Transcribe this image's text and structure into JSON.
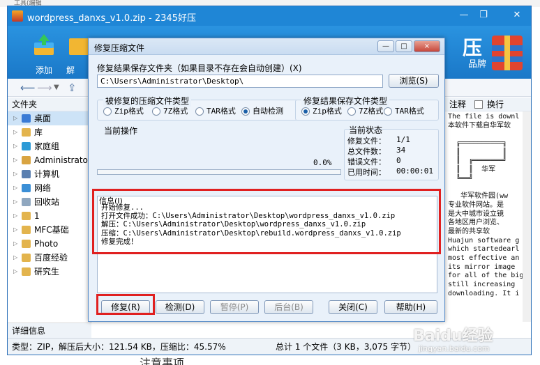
{
  "background": {
    "top_text": "工具(编辑",
    "bottom_text": "注意事项"
  },
  "app": {
    "title": "wordpress_danxs_v1.0.zip - 2345好压",
    "toolbar": {
      "add_label": "添加",
      "extract_label": "解"
    },
    "brand": "压",
    "brand_sub": "品牌"
  },
  "left_panel": {
    "header": "文件夹",
    "items": [
      {
        "label": "桌面",
        "selected": true,
        "icon_color": "#3a7bd5"
      },
      {
        "label": "库",
        "icon_color": "#e3b44d"
      },
      {
        "label": "家庭组",
        "icon_color": "#2c9ad6"
      },
      {
        "label": "Administrator",
        "icon_color": "#d9a441"
      },
      {
        "label": "计算机",
        "icon_color": "#5a7fb0"
      },
      {
        "label": "网络",
        "icon_color": "#3b8fd6"
      },
      {
        "label": "回收站",
        "icon_color": "#8fa7bf"
      },
      {
        "label": "1",
        "icon_color": "#e3b44d"
      },
      {
        "label": "MFC基础",
        "icon_color": "#e3b44d"
      },
      {
        "label": "Photo",
        "icon_color": "#e3b44d"
      },
      {
        "label": "百度经验",
        "icon_color": "#e3b44d"
      },
      {
        "label": "研究生",
        "icon_color": "#e3b44d"
      }
    ],
    "detail_label": "详细信息"
  },
  "right_panel": {
    "header_label": "注释",
    "wrap_label": "换行",
    "preview_lines": [
      "The file is downl",
      "本软件下载自华军软",
      "",
      "  ╔══════════╗",
      "  ║          ║",
      "  ║  ╔═══════╝",
      "  ║  ║  华军",
      "  ╚══╝",
      "",
      "   华军软件园(ww",
      "专业软件网站。是",
      "是大中城市设立镜",
      "各地区用户浏览、",
      "最新的共享软",
      "Huajun software g",
      "which startedearl",
      "most effective an",
      "its mirror image",
      "for all of the big c",
      "still increasing",
      "downloading. It i"
    ]
  },
  "status_bar": {
    "left": "类型：ZIP，解压后大小：121.54 KB，压缩比：45.57%",
    "right": "总计 1 个文件（3 KB，3,075 字节）"
  },
  "dialog": {
    "title": "修复压缩文件",
    "controls": {
      "min": "—",
      "max": "□",
      "close": "×"
    },
    "save_folder_label": "修复结果保存文件夹（如果目录不存在会自动创建）(X)",
    "path_value": "C:\\Users\\Administrator\\Desktop\\",
    "browse_label": "浏览(S)",
    "src_type_group": {
      "title": "被修复的压缩文件类型",
      "options": [
        {
          "label": "Zip格式",
          "checked": false
        },
        {
          "label": "7Z格式",
          "checked": false
        },
        {
          "label": "TAR格式",
          "checked": false
        },
        {
          "label": "自动检测",
          "checked": true
        }
      ]
    },
    "dst_type_group": {
      "title": "修复结果保存文件类型",
      "options": [
        {
          "label": "Zip格式",
          "checked": true
        },
        {
          "label": "7Z格式",
          "checked": false
        },
        {
          "label": "TAR格式",
          "checked": false
        }
      ]
    },
    "current_op": {
      "title": "当前操作",
      "percent_text": "0.0%",
      "progress": 0
    },
    "current_state": {
      "title": "当前状态",
      "rows": [
        {
          "label": "修复文件：",
          "value": "1/1"
        },
        {
          "label": "总文件数：",
          "value": "34"
        },
        {
          "label": "错误文件：",
          "value": "0"
        },
        {
          "label": "已用时间：",
          "value": "00:00:01"
        }
      ]
    },
    "info": {
      "title": "信息(I)",
      "lines": [
        "开始修复...",
        "打开文件成功：C:\\Users\\Administrator\\Desktop\\wordpress_danxs_v1.0.zip",
        "解压：C:\\Users\\Administrator\\Desktop\\wordpress_danxs_v1.0.zip",
        "压缩：C:\\Users\\Administrator\\Desktop\\rebuild.wordpress_danxs_v1.0.zip",
        "修复完成！"
      ]
    },
    "buttons": {
      "repair": "修复(R)",
      "check": "检测(D)",
      "pause": "暂停(P)",
      "background": "后台(B)",
      "close": "关闭(C)",
      "help": "帮助(H)"
    }
  },
  "watermark": {
    "brand": "Baidu经验",
    "url": "jingyan.baidu.com"
  },
  "colors": {
    "titlebar": "#1f86d6",
    "highlight": "#e02020",
    "dialog_bg": "#e9f1fa"
  }
}
